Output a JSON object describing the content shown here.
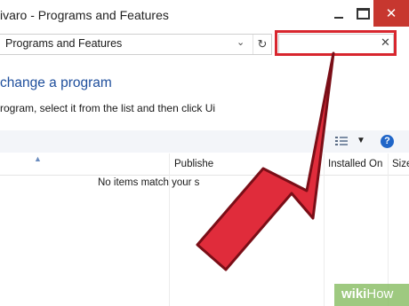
{
  "window": {
    "title": "ivaro - Programs and Features",
    "close_glyph": "✕"
  },
  "address_bar": {
    "path": "Programs and Features",
    "dropdown_glyph": "⌄",
    "refresh_glyph": "↻"
  },
  "search": {
    "value": "",
    "placeholder": "",
    "clear_glyph": "✕"
  },
  "content": {
    "heading": "change a program",
    "instructions": "rogram, select it from the list and then click Ui"
  },
  "toolbar": {
    "view_dropdown_glyph": "▼",
    "help_glyph": "?"
  },
  "list": {
    "columns": [
      "Publishe",
      "Installed On",
      "Size"
    ],
    "empty_message": "No items match your s"
  },
  "watermark": {
    "text_bold": "wiki",
    "text_light": "How"
  },
  "colors": {
    "arrow_fill": "#e02c3b",
    "arrow_stroke": "#8a1019",
    "highlight": "#d8262e",
    "link_heading": "#1e4e9c",
    "close_button": "#c7372f"
  },
  "icons": [
    "minimize-icon",
    "maximize-icon",
    "close-icon",
    "chevron-down-icon",
    "refresh-icon",
    "clear-search-icon",
    "view-options-icon",
    "help-icon",
    "sort-ascending-icon",
    "pointer-arrow"
  ]
}
